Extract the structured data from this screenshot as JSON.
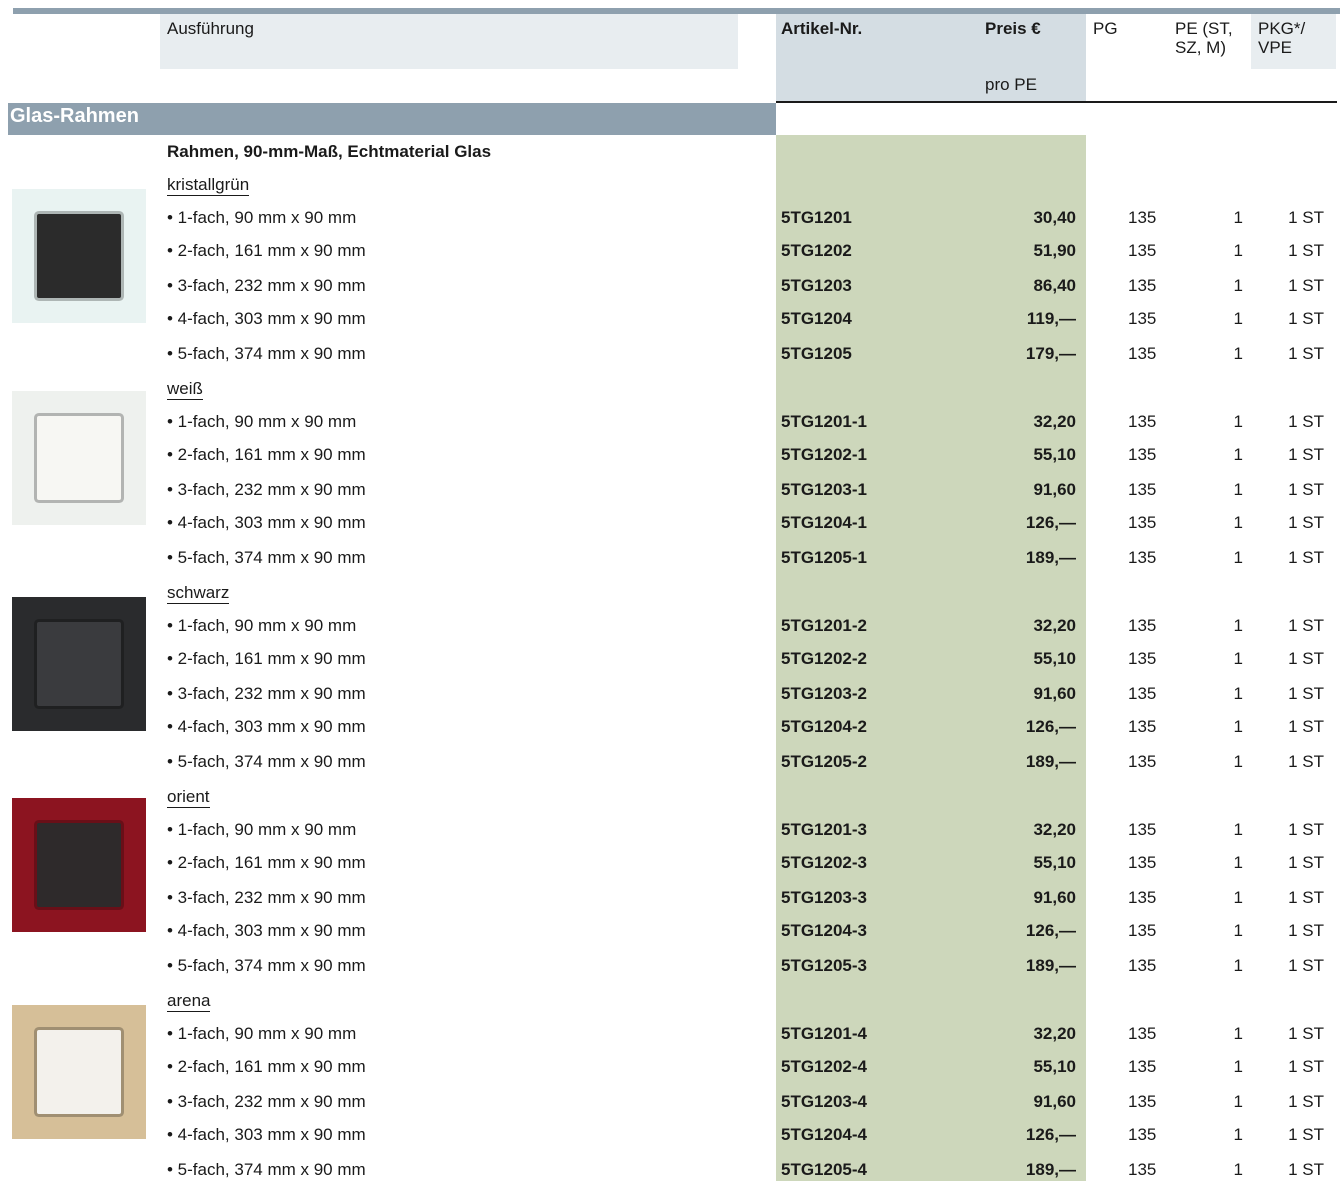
{
  "header": {
    "ausfuehrung": "Ausführung",
    "artikel_nr": "Artikel-Nr.",
    "preis": "Preis €",
    "pro_pe": "pro PE",
    "pg": "PG",
    "pe_line1": "PE (ST,",
    "pe_line2": "SZ, M)",
    "pkg_line1": "PKG*/",
    "pkg_line2": "VPE"
  },
  "section": {
    "title": "Glas-Rahmen",
    "subtitle": "Rahmen, 90-mm-Maß, Echtmaterial Glas"
  },
  "colors": {
    "header_bar": "#8ea0ae",
    "artikel_header_bg": "#d4dde3",
    "green_column": "#cdd7bb"
  },
  "variants": [
    {
      "name": "kristallgrün",
      "image_colors": {
        "frame": "#e9f3f2",
        "inner": "#2b2b2b"
      },
      "rows": [
        {
          "desc": "• 1-fach, 90 mm x 90 mm",
          "art": "5TG1201",
          "price": "30,40",
          "pg": "135",
          "pe": "1",
          "pkg": "1 ST"
        },
        {
          "desc": "• 2-fach, 161 mm x 90 mm",
          "art": "5TG1202",
          "price": "51,90",
          "pg": "135",
          "pe": "1",
          "pkg": "1 ST"
        },
        {
          "desc": "• 3-fach, 232 mm x 90 mm",
          "art": "5TG1203",
          "price": "86,40",
          "pg": "135",
          "pe": "1",
          "pkg": "1 ST"
        },
        {
          "desc": "• 4-fach, 303 mm x 90 mm",
          "art": "5TG1204",
          "price": "119,—",
          "pg": "135",
          "pe": "1",
          "pkg": "1 ST"
        },
        {
          "desc": "• 5-fach, 374 mm x 90 mm",
          "art": "5TG1205",
          "price": "179,—",
          "pg": "135",
          "pe": "1",
          "pkg": "1 ST"
        }
      ]
    },
    {
      "name": "weiß",
      "image_colors": {
        "frame": "#eef1ee",
        "inner": "#f7f7f3"
      },
      "rows": [
        {
          "desc": "• 1-fach, 90 mm x 90 mm",
          "art": "5TG1201-1",
          "price": "32,20",
          "pg": "135",
          "pe": "1",
          "pkg": "1 ST"
        },
        {
          "desc": "• 2-fach, 161 mm x 90 mm",
          "art": "5TG1202-1",
          "price": "55,10",
          "pg": "135",
          "pe": "1",
          "pkg": "1 ST"
        },
        {
          "desc": "• 3-fach, 232 mm x 90 mm",
          "art": "5TG1203-1",
          "price": "91,60",
          "pg": "135",
          "pe": "1",
          "pkg": "1 ST"
        },
        {
          "desc": "• 4-fach, 303 mm x 90 mm",
          "art": "5TG1204-1",
          "price": "126,—",
          "pg": "135",
          "pe": "1",
          "pkg": "1 ST"
        },
        {
          "desc": "• 5-fach, 374 mm x 90 mm",
          "art": "5TG1205-1",
          "price": "189,—",
          "pg": "135",
          "pe": "1",
          "pkg": "1 ST"
        }
      ]
    },
    {
      "name": "schwarz",
      "image_colors": {
        "frame": "#2a2b2d",
        "inner": "#3a3b3e"
      },
      "rows": [
        {
          "desc": "• 1-fach, 90 mm x 90 mm",
          "art": "5TG1201-2",
          "price": "32,20",
          "pg": "135",
          "pe": "1",
          "pkg": "1 ST"
        },
        {
          "desc": "• 2-fach, 161 mm x 90 mm",
          "art": "5TG1202-2",
          "price": "55,10",
          "pg": "135",
          "pe": "1",
          "pkg": "1 ST"
        },
        {
          "desc": "• 3-fach, 232 mm x 90 mm",
          "art": "5TG1203-2",
          "price": "91,60",
          "pg": "135",
          "pe": "1",
          "pkg": "1 ST"
        },
        {
          "desc": "• 4-fach, 303 mm x 90 mm",
          "art": "5TG1204-2",
          "price": "126,—",
          "pg": "135",
          "pe": "1",
          "pkg": "1 ST"
        },
        {
          "desc": "• 5-fach, 374 mm x 90 mm",
          "art": "5TG1205-2",
          "price": "189,—",
          "pg": "135",
          "pe": "1",
          "pkg": "1 ST"
        }
      ]
    },
    {
      "name": "orient",
      "image_colors": {
        "frame": "#8c1420",
        "inner": "#2e2a2b"
      },
      "rows": [
        {
          "desc": "• 1-fach, 90 mm x 90 mm",
          "art": "5TG1201-3",
          "price": "32,20",
          "pg": "135",
          "pe": "1",
          "pkg": "1 ST"
        },
        {
          "desc": "• 2-fach, 161 mm x 90 mm",
          "art": "5TG1202-3",
          "price": "55,10",
          "pg": "135",
          "pe": "1",
          "pkg": "1 ST"
        },
        {
          "desc": "• 3-fach, 232 mm x 90 mm",
          "art": "5TG1203-3",
          "price": "91,60",
          "pg": "135",
          "pe": "1",
          "pkg": "1 ST"
        },
        {
          "desc": "• 4-fach, 303 mm x 90 mm",
          "art": "5TG1204-3",
          "price": "126,—",
          "pg": "135",
          "pe": "1",
          "pkg": "1 ST"
        },
        {
          "desc": "• 5-fach, 374 mm x 90 mm",
          "art": "5TG1205-3",
          "price": "189,—",
          "pg": "135",
          "pe": "1",
          "pkg": "1 ST"
        }
      ]
    },
    {
      "name": "arena",
      "image_colors": {
        "frame": "#d6bf98",
        "inner": "#f3f1ec"
      },
      "rows": [
        {
          "desc": "• 1-fach, 90 mm x 90 mm",
          "art": "5TG1201-4",
          "price": "32,20",
          "pg": "135",
          "pe": "1",
          "pkg": "1 ST"
        },
        {
          "desc": "• 2-fach, 161 mm x 90 mm",
          "art": "5TG1202-4",
          "price": "55,10",
          "pg": "135",
          "pe": "1",
          "pkg": "1 ST"
        },
        {
          "desc": "• 3-fach, 232 mm x 90 mm",
          "art": "5TG1203-4",
          "price": "91,60",
          "pg": "135",
          "pe": "1",
          "pkg": "1 ST"
        },
        {
          "desc": "• 4-fach, 303 mm x 90 mm",
          "art": "5TG1204-4",
          "price": "126,—",
          "pg": "135",
          "pe": "1",
          "pkg": "1 ST"
        },
        {
          "desc": "• 5-fach, 374 mm x 90 mm",
          "art": "5TG1205-4",
          "price": "189,—",
          "pg": "135",
          "pe": "1",
          "pkg": "1 ST"
        }
      ]
    }
  ]
}
